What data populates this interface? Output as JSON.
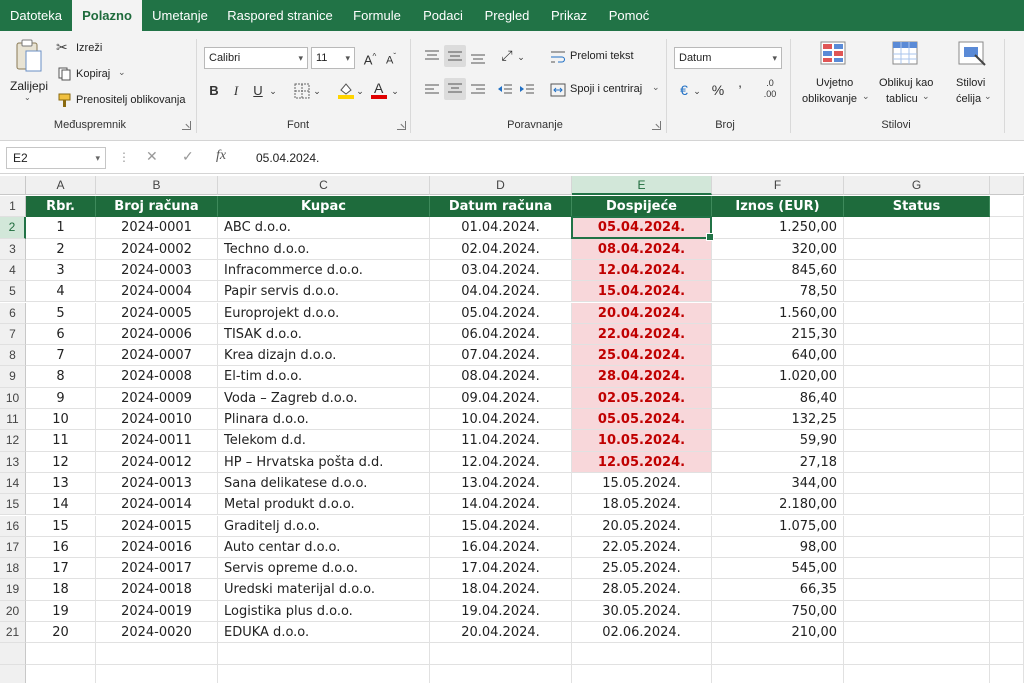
{
  "menu": {
    "tabs": [
      "Datoteka",
      "Polazno",
      "Umetanje",
      "Raspored stranice",
      "Formule",
      "Podaci",
      "Pregled",
      "Prikaz",
      "Pomoć"
    ],
    "active_tab": "Polazno"
  },
  "ribbon": {
    "clipboard": {
      "paste": "Zalijepi",
      "cut": "Izreži",
      "copy": "Kopiraj",
      "format_painter": "Prenositelj oblikovanja",
      "group_label": "Međuspremnik"
    },
    "font": {
      "font_name": "Calibri",
      "font_size": "11",
      "bold": "B",
      "italic": "I",
      "underline": "U",
      "grow": "A",
      "shrink": "A",
      "group_label": "Font",
      "fill_color": "#ffd400",
      "font_color": "#e00000"
    },
    "alignment": {
      "wrap_text": "Prelomi tekst",
      "merge_center": "Spoji i centriraj",
      "group_label": "Poravnanje"
    },
    "number": {
      "format": "Datum",
      "percent": "%",
      "comma": "’",
      "group_label": "Broj"
    },
    "styles": {
      "conditional_formatting_line1": "Uvjetno",
      "conditional_formatting_line2": "oblikovanje",
      "format_as_table_line1": "Oblikuj kao",
      "format_as_table_line2": "tablicu",
      "cell_styles_line1": "Stilovi",
      "cell_styles_line2": "ćelija",
      "group_label": "Stilovi"
    }
  },
  "formula_bar": {
    "name_box": "E2",
    "fx": "fx",
    "content": "05.04.2024."
  },
  "grid": {
    "columns": [
      "A",
      "B",
      "C",
      "D",
      "E",
      "F",
      "G"
    ],
    "selected_column": "E",
    "selected_row": "2",
    "row_numbers": [
      "1",
      "2",
      "3",
      "4",
      "5",
      "6",
      "7",
      "8",
      "9",
      "10",
      "11",
      "12",
      "13",
      "14",
      "15",
      "16",
      "17",
      "18",
      "19",
      "20",
      "21"
    ],
    "headers": [
      "Rbr.",
      "Broj računa",
      "Kupac",
      "Datum računa",
      "Dospijeće",
      "Iznos (EUR)",
      "Status"
    ],
    "rows": [
      [
        "1",
        "2024-0001",
        "ABC d.o.o.",
        "01.04.2024.",
        "05.04.2024.",
        "1.250,00",
        ""
      ],
      [
        "2",
        "2024-0002",
        "Techno d.o.o.",
        "02.04.2024.",
        "08.04.2024.",
        "320,00",
        ""
      ],
      [
        "3",
        "2024-0003",
        "Infracommerce d.o.o.",
        "03.04.2024.",
        "12.04.2024.",
        "845,60",
        ""
      ],
      [
        "4",
        "2024-0004",
        "Papir servis d.o.o.",
        "04.04.2024.",
        "15.04.2024.",
        "78,50",
        ""
      ],
      [
        "5",
        "2024-0005",
        "Europrojekt d.o.o.",
        "05.04.2024.",
        "20.04.2024.",
        "1.560,00",
        ""
      ],
      [
        "6",
        "2024-0006",
        "TISAK d.o.o.",
        "06.04.2024.",
        "22.04.2024.",
        "215,30",
        ""
      ],
      [
        "7",
        "2024-0007",
        "Krea dizajn d.o.o.",
        "07.04.2024.",
        "25.04.2024.",
        "640,00",
        ""
      ],
      [
        "8",
        "2024-0008",
        "El-tim d.o.o.",
        "08.04.2024.",
        "28.04.2024.",
        "1.020,00",
        ""
      ],
      [
        "9",
        "2024-0009",
        "Voda – Zagreb d.o.o.",
        "09.04.2024.",
        "02.05.2024.",
        "86,40",
        ""
      ],
      [
        "10",
        "2024-0010",
        "Plinara d.o.o.",
        "10.04.2024.",
        "05.05.2024.",
        "132,25",
        ""
      ],
      [
        "11",
        "2024-0011",
        "Telekom d.d.",
        "11.04.2024.",
        "10.05.2024.",
        "59,90",
        ""
      ],
      [
        "12",
        "2024-0012",
        "HP – Hrvatska pošta d.d.",
        "12.04.2024.",
        "12.05.2024.",
        "27,18",
        ""
      ],
      [
        "13",
        "2024-0013",
        "Sana delikatese d.o.o.",
        "13.04.2024.",
        "15.05.2024.",
        "344,00",
        ""
      ],
      [
        "14",
        "2024-0014",
        "Metal produkt d.o.o.",
        "14.04.2024.",
        "18.05.2024.",
        "2.180,00",
        ""
      ],
      [
        "15",
        "2024-0015",
        "Graditelj d.o.o.",
        "15.04.2024.",
        "20.05.2024.",
        "1.075,00",
        ""
      ],
      [
        "16",
        "2024-0016",
        "Auto centar d.o.o.",
        "16.04.2024.",
        "22.05.2024.",
        "98,00",
        ""
      ],
      [
        "17",
        "2024-0017",
        "Servis opreme d.o.o.",
        "17.04.2024.",
        "25.05.2024.",
        "545,00",
        ""
      ],
      [
        "18",
        "2024-0018",
        "Uredski materijal d.o.o.",
        "18.04.2024.",
        "28.05.2024.",
        "66,35",
        ""
      ],
      [
        "19",
        "2024-0019",
        "Logistika plus d.o.o.",
        "19.04.2024.",
        "30.05.2024.",
        "750,00",
        ""
      ],
      [
        "20",
        "2024-0020",
        "EDUKA d.o.o.",
        "20.04.2024.",
        "02.06.2024.",
        "210,00",
        ""
      ]
    ],
    "highlighted_due_rows": 12,
    "colors": {
      "header_fill": "#1e6b3c",
      "due_fill": "#f8d7da",
      "due_text": "#c00000",
      "accent": "#217346"
    }
  }
}
